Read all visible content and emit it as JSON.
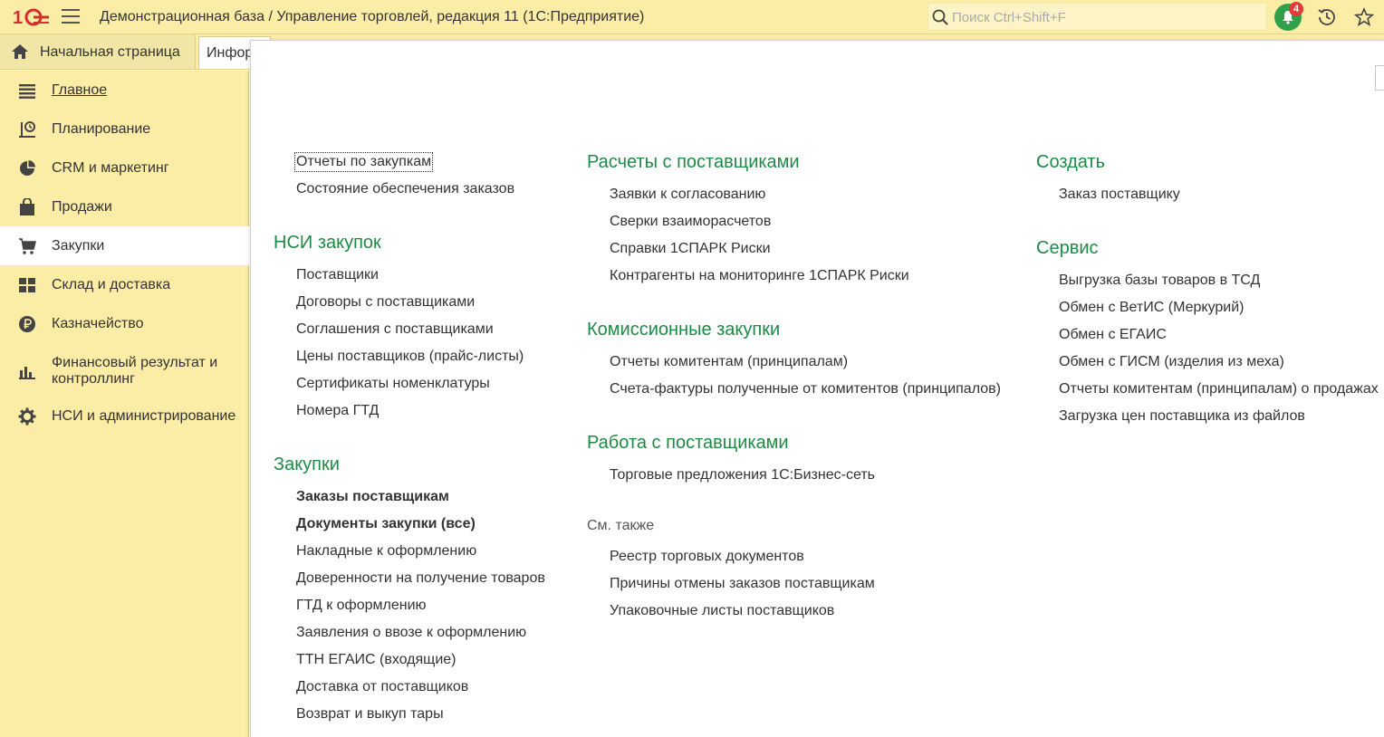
{
  "header": {
    "title": "Демонстрационная база / Управление торговлей, редакция 11  (1С:Предприятие)",
    "search_placeholder": "Поиск Ctrl+Shift+F",
    "notifications_count": "4"
  },
  "tabs": {
    "home": "Начальная страница",
    "info": "Информация"
  },
  "sidebar": {
    "items": [
      {
        "label": "Главное"
      },
      {
        "label": "Планирование"
      },
      {
        "label": "CRM и маркетинг"
      },
      {
        "label": "Продажи"
      },
      {
        "label": "Закупки"
      },
      {
        "label": "Склад и доставка"
      },
      {
        "label": "Казначейство"
      },
      {
        "label": "Финансовый результат и контроллинг"
      },
      {
        "label": "НСИ и администрирование"
      }
    ]
  },
  "main": {
    "col1": {
      "top_links": [
        "Отчеты по закупкам",
        "Состояние обеспечения заказов"
      ],
      "nsi": {
        "title": "НСИ закупок",
        "links": [
          "Поставщики",
          "Договоры с поставщиками",
          "Соглашения с поставщиками",
          "Цены поставщиков (прайс-листы)",
          "Сертификаты номенклатуры",
          "Номера ГТД"
        ]
      },
      "purchases": {
        "title": "Закупки",
        "links": [
          "Заказы поставщикам",
          "Документы закупки (все)",
          "Накладные к оформлению",
          "Доверенности на получение товаров",
          "ГТД к оформлению",
          "Заявления о ввозе к оформлению",
          "ТТН ЕГАИС (входящие)",
          "Доставка от поставщиков",
          "Возврат и выкуп тары"
        ]
      }
    },
    "col2": {
      "settlements": {
        "title": "Расчеты с поставщиками",
        "links": [
          "Заявки к согласованию",
          "Сверки взаиморасчетов",
          "Справки 1СПАРК Риски",
          "Контрагенты на мониторинге 1СПАРК Риски"
        ]
      },
      "commission": {
        "title": "Комиссионные закупки",
        "links": [
          "Отчеты комитентам (принципалам)",
          "Счета-фактуры полученные от комитентов (принципалов)"
        ]
      },
      "suppliers_work": {
        "title": "Работа с поставщиками",
        "links": [
          "Торговые предложения 1С:Бизнес-сеть"
        ]
      },
      "see_also": {
        "title": "См. также",
        "links": [
          "Реестр торговых документов",
          "Причины отмены заказов поставщикам",
          "Упаковочные листы поставщиков"
        ]
      }
    },
    "col3": {
      "create": {
        "title": "Создать",
        "links": [
          "Заказ поставщику"
        ]
      },
      "service": {
        "title": "Сервис",
        "links": [
          "Выгрузка базы товаров в ТСД",
          "Обмен с ВетИС (Меркурий)",
          "Обмен с ЕГАИС",
          "Обмен с ГИСМ (изделия из меха)",
          "Отчеты комитентам (принципалам) о продажах",
          "Загрузка цен поставщика из файлов"
        ]
      }
    }
  },
  "colors": {
    "topbar": "#fbeda6",
    "section_heading": "#1d8a46",
    "notification_green": "#30a14a",
    "badge_red": "#e53935",
    "logo_red": "#d32f2f"
  },
  "icons": [
    "1c-logo",
    "hamburger-icon",
    "search-icon",
    "bell-icon",
    "history-icon",
    "star-icon",
    "home-icon",
    "menu-lines-icon",
    "planning-icon",
    "pie-chart-icon",
    "shopping-bag-icon",
    "cart-icon",
    "grid-icon",
    "ruble-icon",
    "bar-chart-icon",
    "gear-icon"
  ]
}
